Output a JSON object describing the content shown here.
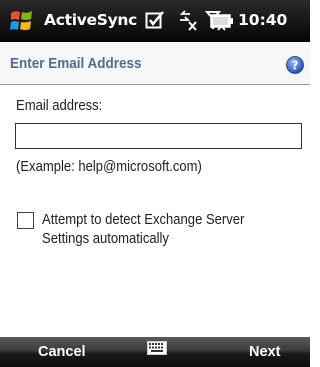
{
  "titlebar": {
    "app_title": "ActiveSync",
    "time": "10:40",
    "icons": [
      "windows-start-icon",
      "sync-status-icon",
      "data-connection-icon",
      "signal-strength-icon",
      "battery-icon"
    ]
  },
  "header": {
    "title": "Enter Email Address",
    "help_icon": "help-icon"
  },
  "form": {
    "email_label": "Email address:",
    "email_value": "",
    "example_text": "(Example: help@microsoft.com)",
    "detect_checkbox_checked": false,
    "detect_label": "Attempt to detect Exchange Server Settings automatically"
  },
  "softkeys": {
    "left": "Cancel",
    "right": "Next",
    "center_icon": "keyboard-icon"
  },
  "colors": {
    "header_title": "#4a6f96",
    "titlebar_bg": "#050505",
    "softkey_bg": "#1a1a1a"
  }
}
